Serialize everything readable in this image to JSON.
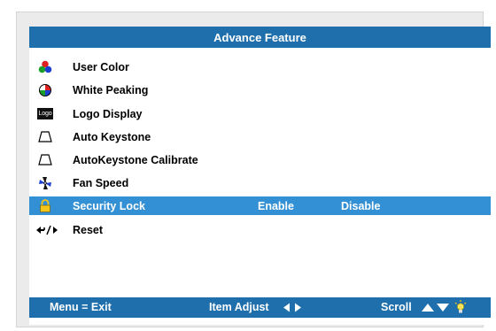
{
  "header": {
    "title": "Advance Feature"
  },
  "menu": {
    "items": [
      {
        "label": "User Color",
        "icon": "user-color-icon"
      },
      {
        "label": "White Peaking",
        "icon": "white-peaking-icon"
      },
      {
        "label": "Logo Display",
        "icon": "logo-icon",
        "icon_text": "Logo"
      },
      {
        "label": "Auto Keystone",
        "icon": "keystone-icon"
      },
      {
        "label": "AutoKeystone Calibrate",
        "icon": "keystone-icon"
      },
      {
        "label": "Fan Speed",
        "icon": "fan-icon"
      },
      {
        "label": "Security Lock",
        "icon": "lock-icon",
        "option_enable": "Enable",
        "option_disable": "Disable",
        "selected": true
      },
      {
        "label": "Reset",
        "icon": "reset-icon"
      }
    ]
  },
  "footer": {
    "exit": "Menu = Exit",
    "adjust": "Item Adjust",
    "scroll": "Scroll"
  },
  "colors": {
    "bar": "#1e6fab",
    "highlight": "#3390d4"
  }
}
